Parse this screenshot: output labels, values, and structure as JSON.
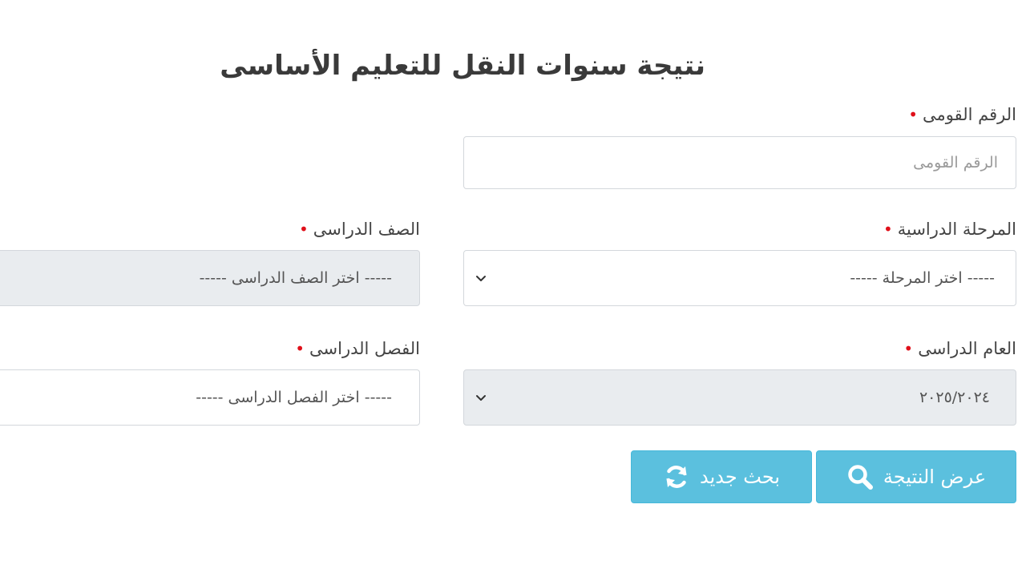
{
  "page": {
    "title": "نتيجة سنوات النقل للتعليم الأساسى"
  },
  "form": {
    "national_id": {
      "label": "الرقم القومى",
      "required_mark": "•",
      "placeholder": "الرقم القومى",
      "value": ""
    },
    "stage": {
      "label": "المرحلة الدراسية",
      "required_mark": "•",
      "selected": "----- اختر المرحلة -----"
    },
    "grade": {
      "label": "الصف الدراسى",
      "required_mark": "•",
      "selected": "----- اختر الصف الدراسى -----"
    },
    "academic_year": {
      "label": "العام الدراسى",
      "required_mark": "•",
      "selected": "٢٠٢٥/٢٠٢٤"
    },
    "term": {
      "label": "الفصل الدراسى",
      "required_mark": "•",
      "selected": "----- اختر الفصل الدراسى -----"
    }
  },
  "buttons": {
    "show_result": "عرض النتيجة",
    "new_search": "بحث جديد"
  },
  "colors": {
    "button_bg": "#5bc0de",
    "required": "#e0101a",
    "disabled_field": "#e9ecef"
  },
  "icons": {
    "show_result": "search-icon",
    "new_search": "refresh-icon",
    "select": "chevron-down-icon"
  }
}
